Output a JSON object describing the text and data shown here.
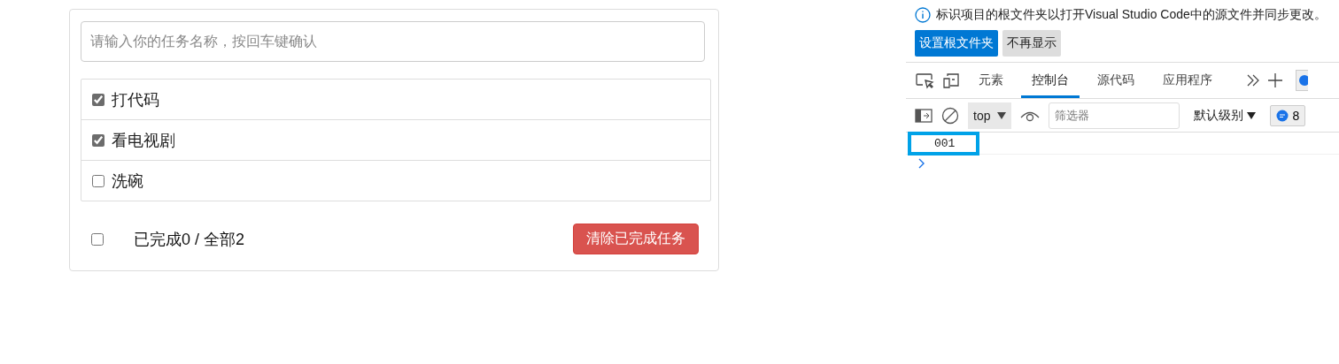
{
  "todo": {
    "input": {
      "placeholder": "请输入你的任务名称，按回车键确认"
    },
    "items": [
      {
        "label": "打代码",
        "checked": true
      },
      {
        "label": "看电视剧",
        "checked": true
      },
      {
        "label": "洗碗",
        "checked": false
      }
    ],
    "footer": {
      "all_checked": false,
      "summary": "已完成0 / 全部2",
      "clear_button": "清除已完成任务"
    }
  },
  "devtools": {
    "notice": {
      "text": "标识项目的根文件夹以打开Visual Studio Code中的源文件并同步更改。",
      "buttons": [
        {
          "label": "设置根文件夹",
          "primary": true
        },
        {
          "label": "不再显示",
          "primary": false
        }
      ]
    },
    "tabs": [
      {
        "label": "元素",
        "selected": false
      },
      {
        "label": "控制台",
        "selected": true
      },
      {
        "label": "源代码",
        "selected": false
      },
      {
        "label": "应用程序",
        "selected": false
      }
    ],
    "filter_bar": {
      "context": "top",
      "placeholder": "筛选器",
      "log_levels": "默认级别",
      "message_count": "8"
    },
    "console": {
      "lines": [
        {
          "text": "001",
          "highlighted": true
        }
      ]
    }
  }
}
